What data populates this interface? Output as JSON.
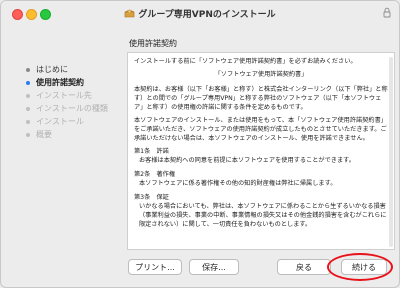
{
  "window": {
    "title": "グループ専用VPNのインストール"
  },
  "sidebar": {
    "steps": [
      {
        "label": "はじめに",
        "state": "done"
      },
      {
        "label": "使用許諾契約",
        "state": "active"
      },
      {
        "label": "インストール先",
        "state": "pending"
      },
      {
        "label": "インストールの種類",
        "state": "pending"
      },
      {
        "label": "インストール",
        "state": "pending"
      },
      {
        "label": "概要",
        "state": "pending"
      }
    ]
  },
  "main": {
    "section_title": "使用許諾契約",
    "license": {
      "intro": "インストールする前に「ソフトウェア使用許諾契約書」を必ずお読みください。",
      "heading": "「ソフトウェア使用許諾契約書」",
      "para1": "本契約は、お客様（以下「お客様」と称す）と株式会社インターリンク（以下「弊社」と称す）との間での「グループ専用VPN」と称する弊社のソフトウェア（以下「本ソフトウェア」と称す）の使用権の許諾に関する条件を定めるものです。",
      "para2": "本ソフトウェアのインストール、または使用をもって、本「ソフトウェア使用許諾契約書」をご承諾いただき、ソフトウェアの使用許諾契約が成立したものとさせていただきます。ご承諾いただけない場合は、本ソフトウェアのインストール、使用を許諾できません。",
      "article1_title": "第1条　許諾",
      "article1_body": "お客様は本契約への同意を前提に本ソフトウェアを使用することができます。",
      "article2_title": "第2条　著作権",
      "article2_body": "本ソフトウェアに係る著作権その他の知的財産権は弊社に帰属します。",
      "article3_title": "第3条　保証",
      "article3_body": "いかなる場合においても、弊社は、本ソフトウェアに係わることから生ずるいかなる損害（事業利益の損失、事業の中断、事業情報の損失又はその他金銭的損害を含むがこれらに限定されない）に関して、一切責任を負わないものとします。"
    }
  },
  "buttons": {
    "print": "プリント...",
    "save": "保存...",
    "back": "戻る",
    "continue": "続ける"
  },
  "colors": {
    "active_step": "#2b7bf1",
    "highlight_ring": "#e8121a",
    "close_light": "#ff5f57",
    "minimize_light": "#febc2e",
    "zoom_light": "#28c840"
  },
  "icons": {
    "title": "package-icon",
    "lock": "lock-icon"
  }
}
